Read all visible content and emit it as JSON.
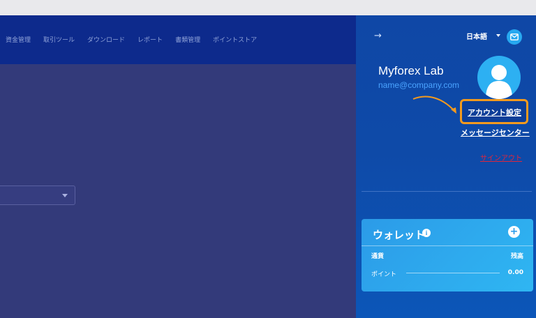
{
  "nav": {
    "items": [
      "資金管理",
      "取引ツール",
      "ダウンロード",
      "レポート",
      "書類管理",
      "ポイントストア"
    ]
  },
  "panel": {
    "back_icon": "arrow-right-icon",
    "language": "日本語",
    "mail_icon": "envelope-icon",
    "user_name": "Myforex Lab",
    "user_email": "name@company.com",
    "account_settings": "アカウント設定",
    "message_center": "メッセージセンター",
    "sign_out": "サインアウト"
  },
  "wallet": {
    "title": "ウォレット",
    "info_glyph": "i",
    "add_glyph": "+",
    "col_currency": "通貨",
    "col_balance": "残高",
    "row_label": "ポイント",
    "row_value": "0.00"
  },
  "colors": {
    "main_bg": "#333a7a",
    "topnav_bg": "#0d2a8c",
    "panel_bg": "#0f47a6",
    "highlight": "#f39a1e",
    "wallet_bg": "#2fb6f2",
    "signout": "#e0263c"
  }
}
